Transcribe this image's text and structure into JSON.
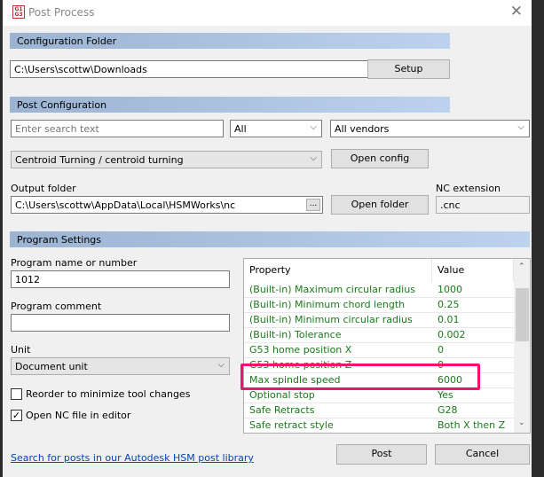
{
  "window": {
    "title": "Post Process",
    "icon": "g1g3-app-icon",
    "icon_text": "G1 G3"
  },
  "config_folder": {
    "header": "Configuration Folder",
    "path": "C:\\Users\\scottw\\Downloads",
    "browse": "...",
    "setup": "Setup"
  },
  "post_config": {
    "header": "Post Configuration",
    "search_placeholder": "Enter search text",
    "filter1": "All",
    "filter2": "All vendors",
    "post": "Centroid Turning / centroid turning",
    "open_config": "Open config",
    "output_label": "Output folder",
    "output_path": "C:\\Users\\scottw\\AppData\\Local\\HSMWorks\\nc",
    "browse": "...",
    "open_folder": "Open folder",
    "nc_ext_label": "NC extension",
    "nc_ext": ".cnc"
  },
  "program": {
    "header": "Program Settings",
    "name_label": "Program name or number",
    "name": "1012",
    "comment_label": "Program comment",
    "comment": "",
    "unit_label": "Unit",
    "unit": "Document unit",
    "reorder": {
      "label": "Reorder to minimize tool changes",
      "checked": false
    },
    "open_nc": {
      "label": "Open NC file in editor",
      "checked": true
    },
    "link": "Search for posts in our Autodesk HSM post library"
  },
  "properties": {
    "col_property": "Property",
    "col_value": "Value",
    "rows": [
      {
        "p": "(Built-in) Maximum circular radius",
        "v": "1000"
      },
      {
        "p": "(Built-in) Minimum chord length",
        "v": "0.25"
      },
      {
        "p": "(Built-in) Minimum circular radius",
        "v": "0.01"
      },
      {
        "p": "(Built-in) Tolerance",
        "v": "0.002"
      },
      {
        "p": "G53 home position X",
        "v": "0"
      },
      {
        "p": "G53 home position Z",
        "v": "0"
      },
      {
        "p": "Max spindle speed",
        "v": "6000"
      },
      {
        "p": "Optional stop",
        "v": "Yes"
      },
      {
        "p": "Safe Retracts",
        "v": "G28"
      },
      {
        "p": "Safe retract style",
        "v": "Both X then Z"
      }
    ],
    "highlight_color": "#f0146e",
    "text_color": "#1a7a1a"
  },
  "buttons": {
    "post": "Post",
    "cancel": "Cancel"
  }
}
